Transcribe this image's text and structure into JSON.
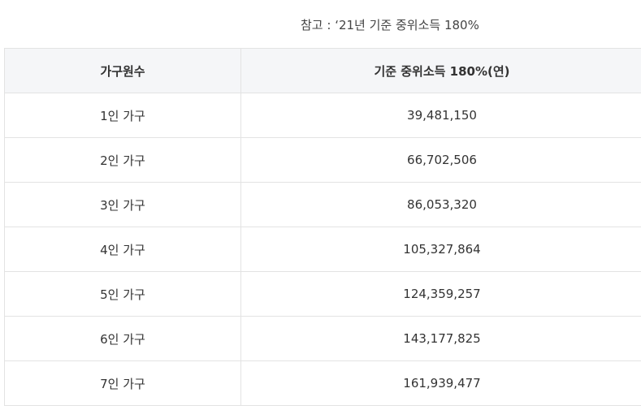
{
  "note": "참고 : ‘21년 기준 중위소득 180%",
  "table": {
    "headers": [
      "가구원수",
      "기준 중위소득 180%(연)"
    ],
    "rows": [
      {
        "household": "1인 가구",
        "income": "39,481,150"
      },
      {
        "household": "2인 가구",
        "income": "66,702,506"
      },
      {
        "household": "3인 가구",
        "income": "86,053,320"
      },
      {
        "household": "4인 가구",
        "income": "105,327,864"
      },
      {
        "household": "5인 가구",
        "income": "124,359,257"
      },
      {
        "household": "6인 가구",
        "income": "143,177,825"
      },
      {
        "household": "7인 가구",
        "income": "161,939,477"
      }
    ]
  }
}
